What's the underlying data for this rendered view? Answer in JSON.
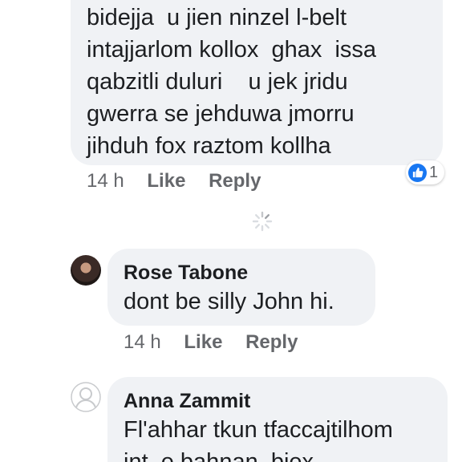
{
  "comments": [
    {
      "lines": [
        "bidejja  u jien ninzel l-belt",
        "intajjarlom kollox  ghax  issa",
        "qabzitli duluri    u jek jridu",
        "gwerra se jehduwa jmorru",
        "jihduh fox raztom kollha"
      ],
      "time": "14 h",
      "like_label": "Like",
      "reply_label": "Reply",
      "reaction": {
        "icon": "thumbs-up-icon",
        "count": "1",
        "color": "#1877f2"
      }
    },
    {
      "author": "Rose Tabone",
      "text": "dont be silly John hi.",
      "time": "14 h",
      "like_label": "Like",
      "reply_label": "Reply"
    },
    {
      "author": "Anna Zammit",
      "lines": [
        "Fl'ahhar tkun tfaccajtilhom",
        "int  e bahnan  biex"
      ]
    }
  ],
  "colors": {
    "bubble": "#f0f2f5",
    "text": "#1c1e21",
    "meta": "#65676b",
    "accent": "#1877f2"
  }
}
